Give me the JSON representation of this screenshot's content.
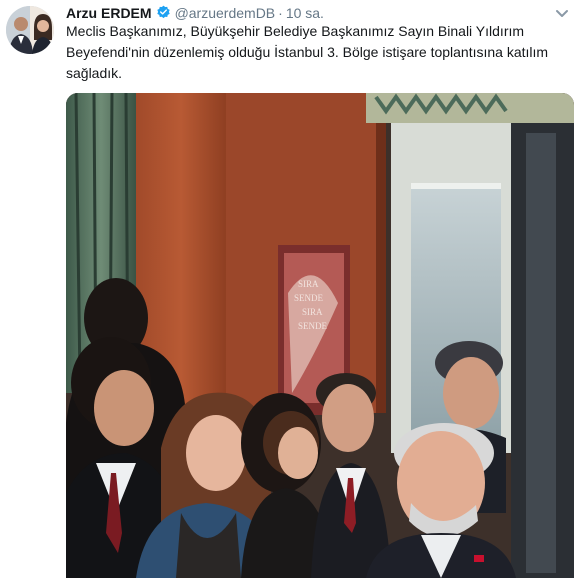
{
  "author": {
    "name": "Arzu ERDEM",
    "handle": "@arzuerdemDB",
    "separator": "·",
    "time": "10 sa."
  },
  "tweet": {
    "line1": "Meclis Başkanımız, Büyükşehir Belediye Başkanımız Sayın Binali Yıldırım",
    "line2": "Beyefendi'nin düzenlemiş olduğu İstanbul 3. Bölge istişare toplantısına katılım",
    "line3": "sağladık."
  },
  "poster": {
    "line1": "SIRA",
    "line2": "SENDE",
    "line3": "SIRA",
    "line4": "SENDE"
  },
  "colors": {
    "verified": "#1da1f2",
    "name_text": "#14171a",
    "meta_text": "#657786"
  },
  "icons": {
    "verified": "verified-badge-icon",
    "more": "chevron-down-icon"
  }
}
